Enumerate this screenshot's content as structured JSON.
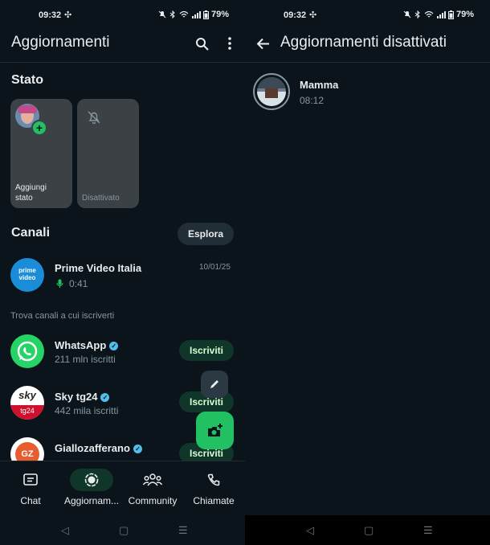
{
  "left": {
    "status": {
      "time": "09:32",
      "battery": "79%"
    },
    "appbar": {
      "title": "Aggiornamenti"
    },
    "stato": {
      "title": "Stato",
      "add_label": "Aggiungi stato",
      "muted_label": "Disattivato"
    },
    "canali": {
      "title": "Canali",
      "explore": "Esplora",
      "followed": [
        {
          "name": "Prime Video Italia",
          "sub": "0:41",
          "date": "10/01/25"
        }
      ],
      "find_label": "Trova canali a cui iscriverti",
      "suggested": [
        {
          "name": "WhatsApp",
          "sub": "211 mln iscritti",
          "button": "Iscriviti"
        },
        {
          "name": "Sky tg24",
          "sub": "442 mila iscritti",
          "button": "Iscriviti"
        },
        {
          "name": "Giallozafferano",
          "sub": "",
          "button": "Iscriviti"
        }
      ]
    },
    "nav": {
      "items": [
        {
          "label": "Chat"
        },
        {
          "label": "Aggiornam..."
        },
        {
          "label": "Community"
        },
        {
          "label": "Chiamate"
        }
      ]
    }
  },
  "right": {
    "status": {
      "time": "09:32",
      "battery": "79%"
    },
    "appbar": {
      "title": "Aggiornamenti disattivati"
    },
    "muted_items": [
      {
        "name": "Mamma",
        "time": "08:12"
      }
    ]
  },
  "colors": {
    "background": "#0b141a",
    "accent": "#21c063",
    "subscribe_bg": "#103529",
    "verified": "#53bdeb"
  }
}
